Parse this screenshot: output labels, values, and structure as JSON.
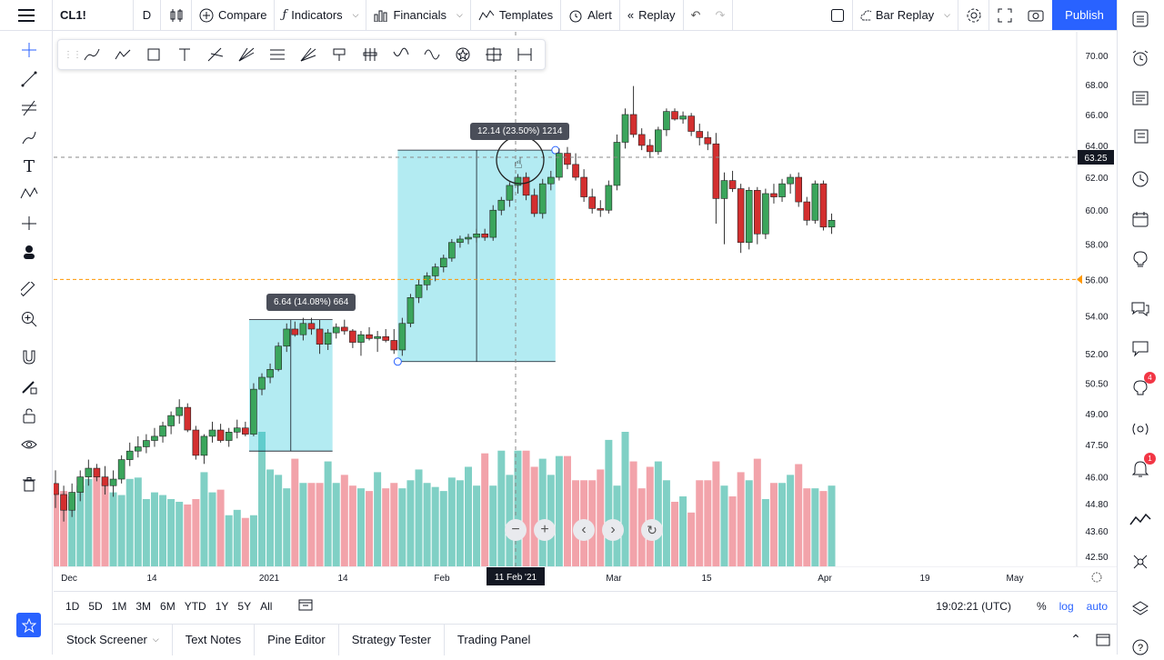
{
  "toolbar": {
    "symbol": "CL1!",
    "interval": "D",
    "compare": "Compare",
    "indicators": "Indicators",
    "financials": "Financials",
    "templates": "Templates",
    "alert": "Alert",
    "replay": "Replay",
    "bar_replay": "Bar Replay",
    "publish": "Publish"
  },
  "price_axis": {
    "labels": [
      "70.00",
      "68.00",
      "66.00",
      "64.00",
      "62.00",
      "60.00",
      "58.00",
      "56.00",
      "54.00",
      "52.00",
      "50.50",
      "49.00",
      "47.50",
      "46.00",
      "44.80",
      "43.60",
      "42.50"
    ],
    "current_price": "63.25",
    "current_price_color": "#131722",
    "alert_level": "56.00",
    "alert_color": "#ff9800"
  },
  "time_axis": {
    "labels": [
      "Dec",
      "14",
      "2021",
      "14",
      "Feb",
      "Mar",
      "15",
      "Apr",
      "19",
      "May"
    ],
    "cursor_label": "11 Feb '21"
  },
  "measurements": [
    {
      "text": "6.64 (14.08%) 664"
    },
    {
      "text": "12.14 (23.50%) 1214"
    }
  ],
  "chart_data": {
    "type": "candlestick",
    "symbol": "CL1!",
    "interval": "D",
    "up_color": "#26a69a",
    "down_color": "#ef5350",
    "ylim": [
      42.0,
      70.6
    ],
    "candles": [
      [
        45.7,
        46.3,
        44.6,
        45.2
      ],
      [
        45.2,
        45.6,
        44.0,
        44.5
      ],
      [
        44.5,
        45.7,
        44.2,
        45.3
      ],
      [
        45.3,
        46.3,
        44.9,
        46.0
      ],
      [
        46.0,
        46.8,
        45.6,
        46.4
      ],
      [
        46.4,
        46.6,
        45.8,
        46.0
      ],
      [
        46.0,
        46.5,
        45.2,
        45.6
      ],
      [
        45.6,
        46.3,
        45.1,
        45.9
      ],
      [
        45.9,
        47.0,
        45.7,
        46.8
      ],
      [
        46.8,
        47.6,
        46.5,
        47.2
      ],
      [
        47.2,
        47.9,
        46.9,
        47.4
      ],
      [
        47.4,
        48.0,
        47.1,
        47.7
      ],
      [
        47.7,
        48.3,
        47.4,
        47.9
      ],
      [
        47.9,
        48.6,
        47.6,
        48.4
      ],
      [
        48.4,
        49.1,
        48.0,
        48.9
      ],
      [
        48.9,
        49.7,
        48.5,
        49.3
      ],
      [
        49.3,
        49.5,
        48.1,
        48.2
      ],
      [
        48.2,
        48.4,
        46.8,
        47.0
      ],
      [
        47.0,
        48.0,
        46.6,
        47.9
      ],
      [
        47.9,
        48.6,
        47.6,
        48.2
      ],
      [
        48.2,
        48.5,
        47.6,
        47.7
      ],
      [
        47.7,
        48.3,
        47.4,
        48.1
      ],
      [
        48.1,
        48.7,
        47.8,
        48.3
      ],
      [
        48.3,
        48.6,
        47.9,
        48.0
      ],
      [
        48.0,
        50.5,
        47.9,
        50.2
      ],
      [
        50.2,
        51.0,
        49.9,
        50.8
      ],
      [
        50.8,
        51.5,
        50.5,
        51.2
      ],
      [
        51.2,
        52.6,
        51.1,
        52.4
      ],
      [
        52.4,
        53.6,
        52.1,
        53.3
      ],
      [
        53.3,
        53.7,
        52.9,
        53.0
      ],
      [
        53.0,
        53.9,
        52.7,
        53.6
      ],
      [
        53.6,
        53.9,
        53.0,
        53.3
      ],
      [
        53.3,
        53.8,
        52.0,
        52.5
      ],
      [
        52.5,
        53.3,
        52.2,
        53.1
      ],
      [
        53.1,
        53.6,
        52.8,
        53.4
      ],
      [
        53.4,
        53.8,
        53.0,
        53.2
      ],
      [
        53.2,
        53.3,
        52.3,
        52.6
      ],
      [
        52.6,
        53.2,
        51.9,
        53.0
      ],
      [
        53.0,
        53.4,
        52.7,
        52.8
      ],
      [
        52.8,
        53.2,
        52.1,
        52.9
      ],
      [
        52.9,
        53.3,
        52.6,
        52.7
      ],
      [
        52.7,
        53.3,
        52.0,
        52.2
      ],
      [
        52.2,
        53.9,
        51.9,
        53.6
      ],
      [
        53.6,
        55.2,
        53.4,
        55.0
      ],
      [
        55.0,
        56.0,
        54.7,
        55.7
      ],
      [
        55.7,
        56.4,
        55.4,
        56.2
      ],
      [
        56.2,
        56.9,
        55.9,
        56.7
      ],
      [
        56.7,
        57.4,
        56.4,
        57.2
      ],
      [
        57.2,
        58.3,
        57.0,
        58.1
      ],
      [
        58.1,
        58.5,
        57.8,
        58.3
      ],
      [
        58.3,
        58.6,
        58.0,
        58.4
      ],
      [
        58.4,
        58.9,
        58.1,
        58.6
      ],
      [
        58.6,
        58.9,
        58.2,
        58.4
      ],
      [
        58.4,
        60.3,
        58.2,
        60.0
      ],
      [
        60.0,
        60.8,
        59.7,
        60.6
      ],
      [
        60.6,
        61.7,
        60.2,
        61.5
      ],
      [
        61.5,
        62.2,
        61.0,
        62.0
      ],
      [
        62.0,
        62.3,
        60.6,
        60.9
      ],
      [
        60.9,
        61.3,
        59.6,
        59.8
      ],
      [
        59.8,
        61.9,
        59.5,
        61.6
      ],
      [
        61.6,
        62.4,
        61.2,
        62.0
      ],
      [
        62.0,
        63.8,
        61.8,
        63.5
      ],
      [
        63.5,
        63.9,
        62.5,
        62.8
      ],
      [
        62.8,
        63.5,
        61.8,
        62.0
      ],
      [
        62.0,
        62.5,
        60.5,
        60.8
      ],
      [
        60.8,
        61.3,
        59.8,
        60.1
      ],
      [
        60.1,
        60.6,
        59.6,
        60.0
      ],
      [
        60.0,
        61.8,
        59.8,
        61.5
      ],
      [
        61.5,
        64.7,
        61.2,
        64.2
      ],
      [
        64.2,
        66.4,
        63.8,
        66.0
      ],
      [
        66.0,
        67.9,
        64.5,
        64.7
      ],
      [
        64.7,
        65.1,
        63.7,
        64.0
      ],
      [
        64.0,
        64.4,
        63.2,
        63.6
      ],
      [
        63.6,
        65.2,
        63.4,
        65.0
      ],
      [
        65.0,
        66.4,
        64.6,
        66.2
      ],
      [
        66.2,
        66.4,
        65.6,
        65.7
      ],
      [
        65.7,
        66.2,
        65.4,
        65.9
      ],
      [
        65.9,
        66.1,
        64.6,
        64.9
      ],
      [
        64.9,
        65.4,
        64.0,
        64.5
      ],
      [
        64.5,
        64.9,
        63.7,
        64.1
      ],
      [
        64.1,
        64.8,
        59.2,
        60.7
      ],
      [
        60.7,
        62.3,
        58.0,
        61.8
      ],
      [
        61.8,
        62.4,
        61.1,
        61.3
      ],
      [
        61.3,
        61.6,
        57.5,
        58.1
      ],
      [
        58.1,
        61.4,
        57.7,
        61.2
      ],
      [
        61.2,
        61.4,
        58.0,
        58.6
      ],
      [
        58.6,
        61.3,
        58.3,
        61.0
      ],
      [
        61.0,
        61.6,
        60.4,
        60.8
      ],
      [
        60.8,
        61.9,
        60.5,
        61.6
      ],
      [
        61.6,
        62.2,
        61.0,
        62.0
      ],
      [
        62.0,
        62.3,
        60.2,
        60.5
      ],
      [
        60.5,
        60.8,
        59.1,
        59.4
      ],
      [
        59.4,
        61.8,
        59.2,
        61.6
      ],
      [
        61.6,
        61.8,
        58.8,
        59.0
      ],
      [
        59.0,
        59.8,
        58.6,
        59.4
      ]
    ],
    "volume_relative": [
      0.55,
      0.56,
      0.52,
      0.6,
      0.65,
      0.67,
      0.62,
      0.55,
      0.53,
      0.65,
      0.66,
      0.5,
      0.55,
      0.53,
      0.5,
      0.48,
      0.46,
      0.5,
      0.7,
      0.55,
      0.57,
      0.38,
      0.42,
      0.36,
      0.38,
      1.0,
      0.72,
      0.68,
      0.58,
      0.8,
      0.62,
      0.62,
      0.62,
      0.78,
      0.62,
      0.68,
      0.6,
      0.58,
      0.56,
      0.7,
      0.58,
      0.62,
      0.58,
      0.64,
      0.72,
      0.62,
      0.59,
      0.56,
      0.66,
      0.64,
      0.74,
      0.6,
      0.84,
      0.6,
      0.86,
      0.68,
      0.86,
      0.86,
      0.74,
      0.8,
      0.68,
      0.82,
      0.82,
      0.64,
      0.64,
      0.64,
      0.72,
      0.94,
      0.6,
      1.0,
      0.78,
      0.58,
      0.74,
      0.78,
      0.64,
      0.48,
      0.52,
      0.4,
      0.64,
      0.64,
      0.78,
      0.6,
      0.52,
      0.7,
      0.64,
      0.8,
      0.5,
      0.62,
      0.62,
      0.68,
      0.76,
      0.58,
      0.58,
      0.56,
      0.6
    ],
    "measure_ranges": [
      {
        "from_index": 24,
        "to_index": 33,
        "low": 47.2,
        "high": 53.8,
        "label": "6.64 (14.08%) 664"
      },
      {
        "from_index": 42,
        "to_index": 60,
        "low": 51.6,
        "high": 63.7,
        "label": "12.14 (23.50%) 1214"
      }
    ],
    "horizontal_line": 56.0,
    "crosshair_price": 63.25
  },
  "time_ranges": [
    "1D",
    "5D",
    "1M",
    "3M",
    "6M",
    "YTD",
    "1Y",
    "5Y",
    "All"
  ],
  "status": {
    "clock": "19:02:21 (UTC)",
    "percent": "%",
    "log": "log",
    "auto": "auto"
  },
  "panels": [
    "Stock Screener",
    "Text Notes",
    "Pine Editor",
    "Strategy Tester",
    "Trading Panel"
  ],
  "right_badges": {
    "ideas": "4",
    "notifications": "1"
  }
}
